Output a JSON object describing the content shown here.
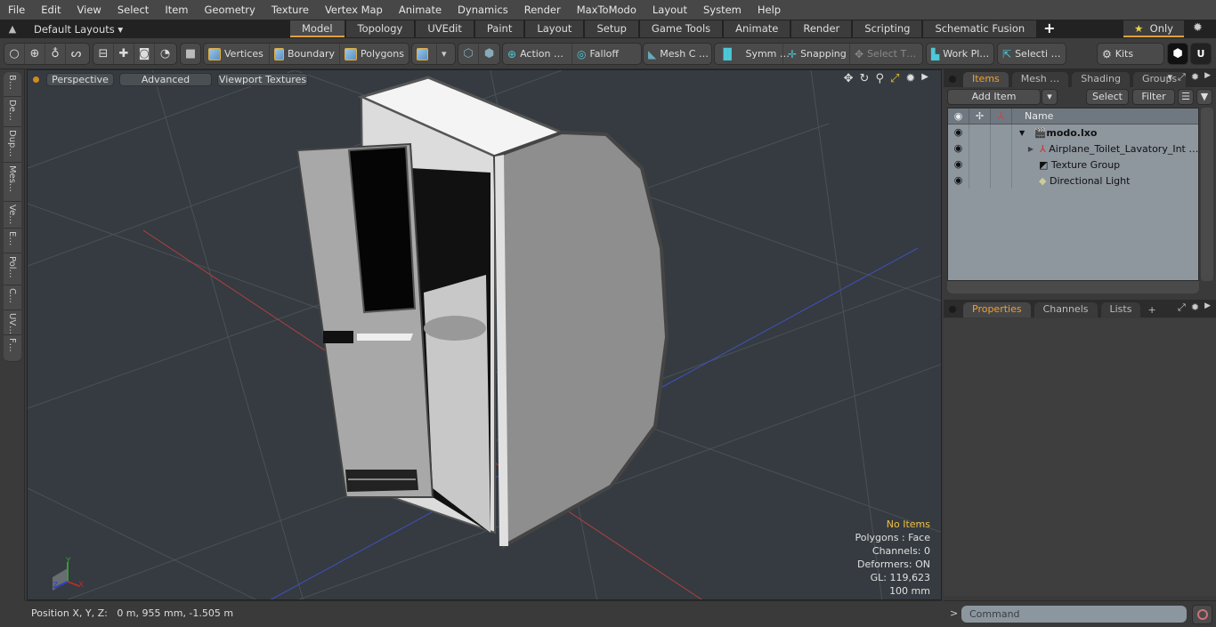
{
  "menu": [
    "File",
    "Edit",
    "View",
    "Select",
    "Item",
    "Geometry",
    "Texture",
    "Vertex Map",
    "Animate",
    "Dynamics",
    "Render",
    "MaxToModo",
    "Layout",
    "System",
    "Help"
  ],
  "layout_bar": {
    "default_layouts": "Default Layouts ▾",
    "tabs": [
      "Model",
      "Topology",
      "UVEdit",
      "Paint",
      "Layout",
      "Setup",
      "Game Tools",
      "Animate",
      "Render",
      "Scripting",
      "Schematic Fusion"
    ],
    "active_tab": "Model",
    "add_tab": "+",
    "only_label": "Only",
    "star": "★"
  },
  "toolbar": {
    "vertices": "Vertices",
    "boundary": "Boundary",
    "polygons": "Polygons",
    "action": "Action   …",
    "falloff": "Falloff",
    "mesh_c": "Mesh C …",
    "symm": "Symm …",
    "snapping": "Snapping",
    "select_t": "Select T…",
    "work_pl": "Work Pl…",
    "selecti": "Selecti …",
    "kits": "Kits"
  },
  "left_tabs": [
    "B…",
    "De…",
    "Dup…",
    "Mes…",
    "Ve…",
    "E…",
    "Pol…",
    "C…",
    "UV…",
    "F…"
  ],
  "viewport": {
    "perspective": "Perspective",
    "advanced": "Advanced",
    "viewport_textures": "Viewport Textures",
    "hud": {
      "selection": "No Items",
      "polygons": "Polygons : Face",
      "channels": "Channels: 0",
      "deformers": "Deformers: ON",
      "gl": "GL: 119,623",
      "scale": "100 mm"
    },
    "axis_labels": {
      "x": "X",
      "y": "Y",
      "z": "Z"
    }
  },
  "status": {
    "position_label": "Position X, Y, Z:",
    "position_value": "0 m, 955 mm, -1.505 m"
  },
  "items_panel": {
    "tabs": [
      "Items",
      "Mesh …",
      "Shading",
      "Groups"
    ],
    "active_tab": "Items",
    "add_item": "Add Item",
    "select": "Select",
    "filter": "Filter",
    "name_header": "Name",
    "rows": [
      {
        "name": "modo.lxo",
        "bold": true,
        "icon": "scene-icon"
      },
      {
        "name": "Airplane_Toilet_Lavatory_Int …",
        "bold": false,
        "icon": "mesh-locator-icon"
      },
      {
        "name": "Texture Group",
        "bold": false,
        "icon": "folder-icon"
      },
      {
        "name": "Directional Light",
        "bold": false,
        "icon": "light-icon"
      }
    ]
  },
  "properties_panel": {
    "tabs": [
      "Properties",
      "Channels",
      "Lists"
    ],
    "active_tab": "Properties",
    "add_tab": "+"
  },
  "command": {
    "prompt": ">",
    "placeholder": "Command"
  }
}
